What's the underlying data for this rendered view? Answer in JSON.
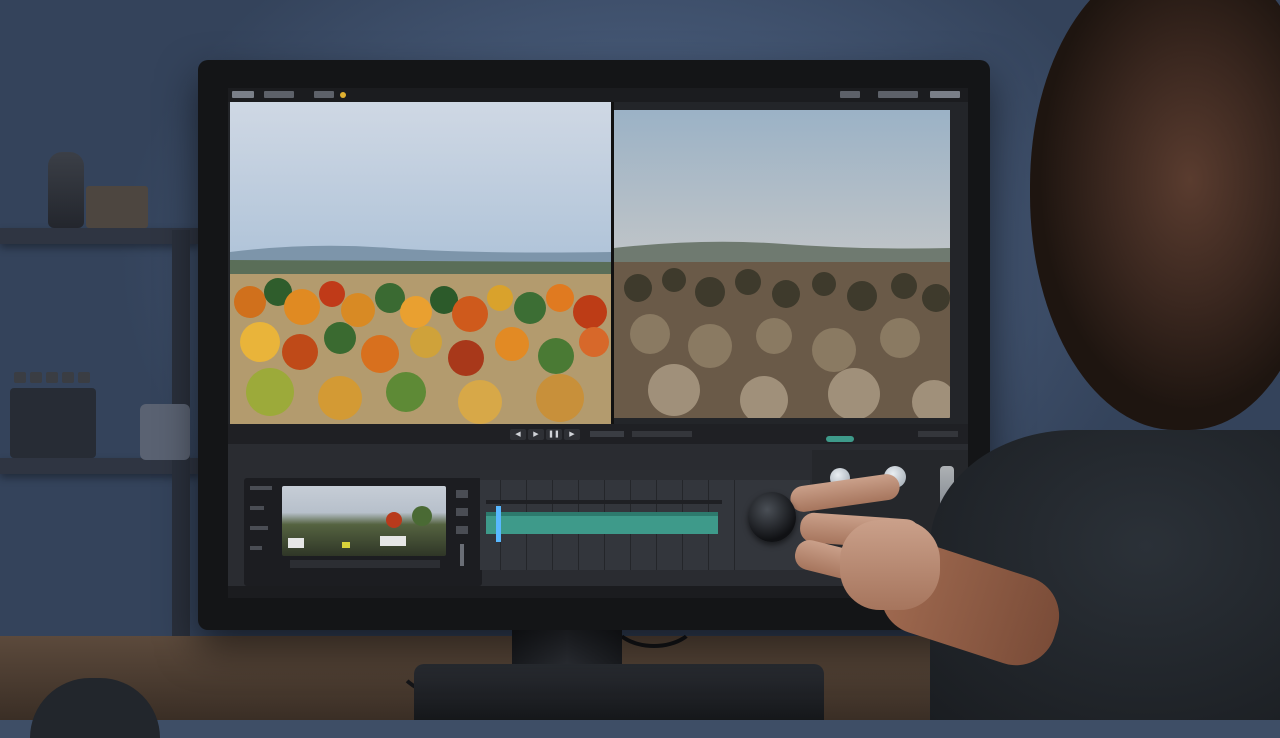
{
  "scene": {
    "description_free": true,
    "colors": {
      "wall": "#475a78",
      "bezel": "#141517",
      "screen_bg": "#232529",
      "timeline_track": "#3e9a8a",
      "playhead": "#58b8ff",
      "desk": "#5c4a3c"
    }
  },
  "app": {
    "menu_icons": [
      "app-menu-icon",
      "file-menu-icon",
      "edit-menu-icon",
      "view-menu-icon"
    ],
    "top_right_icons": [
      "wifi-icon",
      "search-icon",
      "window-controls-icon"
    ]
  },
  "viewers": {
    "left_icon": "color-graded-viewer",
    "right_icon": "original-viewer"
  },
  "transport": {
    "buttons": [
      {
        "name": "prev-frame-button",
        "glyph": "◀"
      },
      {
        "name": "play-button",
        "glyph": "▶"
      },
      {
        "name": "pause-button",
        "glyph": "❚❚"
      },
      {
        "name": "next-frame-button",
        "glyph": "▶"
      }
    ]
  },
  "right_panel": {
    "icons": [
      "color-wheel-icon",
      "lift-knob-icon",
      "gain-knob-icon",
      "exposure-icon"
    ]
  }
}
